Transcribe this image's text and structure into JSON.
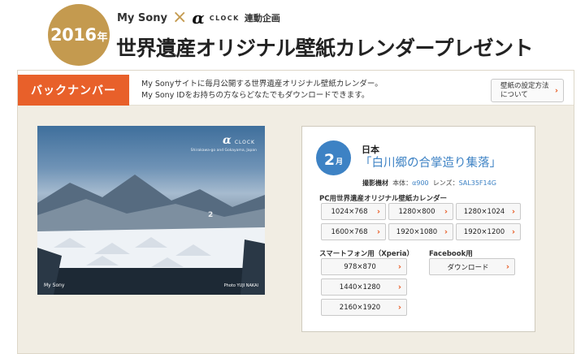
{
  "header": {
    "year": "2016",
    "year_suffix": "年",
    "brand": "My Sony",
    "cross": "×",
    "alpha": "α",
    "clock": "CLOCK",
    "collab": "連動企画",
    "title": "世界遺産オリジナル壁紙カレンダープレゼント"
  },
  "backnumber": {
    "label": "バックナンバー",
    "desc_line1": "My Sonyサイトに毎月公開する世界遺産オリジナル壁紙カレンダー。",
    "desc_line2": "My Sony IDをお持ちの方ならどなたでもダウンロードできます。",
    "settings_line1": "壁紙の設定方法",
    "settings_line2": "について"
  },
  "photo": {
    "logo_alpha": "α",
    "logo_clock": "CLOCK",
    "place": "Shirakawa-go and Gokayama, Japan",
    "month": "2",
    "sony": "My Sony",
    "credit": "Photo YUJI NAKAI"
  },
  "info": {
    "month": "2",
    "month_suffix": "月",
    "country": "日本",
    "site": "「白川郷の合掌造り集落」",
    "equip_label": "撮影機材",
    "body_label": "本体：",
    "body_value": "α900",
    "lens_label": "レンズ：",
    "lens_value": "SAL35F14G",
    "pc_title": "PC用世界遺産オリジナル壁紙カレンダー",
    "pc_sizes": [
      "1024×768",
      "1280×800",
      "1280×1024",
      "1600×768",
      "1920×1080",
      "1920×1200"
    ],
    "sp_title": "スマートフォン用（Xperia）",
    "sp_sizes": [
      "978×870",
      "1440×1280",
      "2160×1920"
    ],
    "fb_title": "Facebook用",
    "fb_button": "ダウンロード"
  },
  "colors": {
    "accent_orange": "#e8602a",
    "accent_blue": "#3d82c4",
    "gold": "#c49a4f"
  }
}
